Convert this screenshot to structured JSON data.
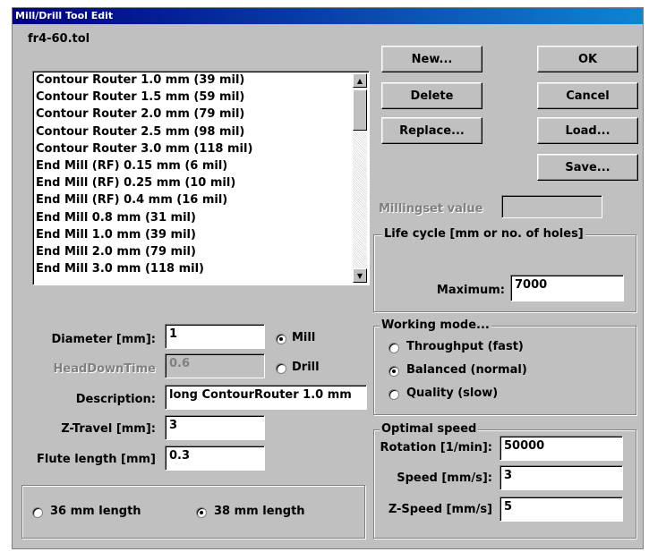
{
  "window": {
    "title": "Mill/Drill Tool Edit"
  },
  "file": {
    "name": "fr4-60.tol"
  },
  "tool_list": {
    "items": [
      "Contour Router 1.0 mm (39 mil)",
      "Contour Router 1.5 mm (59 mil)",
      "Contour Router 2.0 mm (79 mil)",
      "Contour Router 2.5 mm (98 mil)",
      "Contour Router 3.0 mm (118 mil)",
      "End Mill (RF) 0.15 mm (6 mil)",
      "End Mill (RF) 0.25 mm (10 mil)",
      "End Mill (RF) 0.4 mm (16 mil)",
      "End Mill 0.8 mm (31 mil)",
      "End Mill 1.0 mm (39 mil)",
      "End Mill 2.0 mm (79 mil)",
      "End Mill 3.0 mm (118 mil)"
    ]
  },
  "buttons": {
    "new": "New...",
    "delete": "Delete",
    "replace": "Replace...",
    "ok": "OK",
    "cancel": "Cancel",
    "load": "Load...",
    "save": "Save..."
  },
  "millingset": {
    "label": "Millingset value",
    "value": ""
  },
  "life_cycle": {
    "title": "Life cycle [mm or no. of holes]",
    "maximum_label": "Maximum:",
    "maximum_value": "7000"
  },
  "tool": {
    "diameter_label": "Diameter [mm]:",
    "diameter_value": "1",
    "headdown_label": "HeadDownTime",
    "headdown_value": "0.6",
    "description_label": "Description:",
    "description_value": "long ContourRouter 1.0 mm",
    "ztravel_label": "Z-Travel [mm]:",
    "ztravel_value": "3",
    "flute_label": "Flute length [mm]",
    "flute_value": "0.3",
    "type_mill": "Mill",
    "type_drill": "Drill",
    "type_selected": "Mill"
  },
  "length": {
    "opt36": "36 mm length",
    "opt38": "38 mm length",
    "selected": "38 mm length"
  },
  "working_mode": {
    "title": "Working mode...",
    "options": [
      "Throughput (fast)",
      "Balanced (normal)",
      "Quality (slow)"
    ],
    "selected": "Balanced (normal)"
  },
  "optimal_speed": {
    "title": "Optimal speed",
    "rotation_label": "Rotation [1/min]:",
    "rotation_value": "50000",
    "speed_label": "Speed [mm/s]:",
    "speed_value": "3",
    "zspeed_label": "Z-Speed [mm/s]",
    "zspeed_value": "5"
  }
}
